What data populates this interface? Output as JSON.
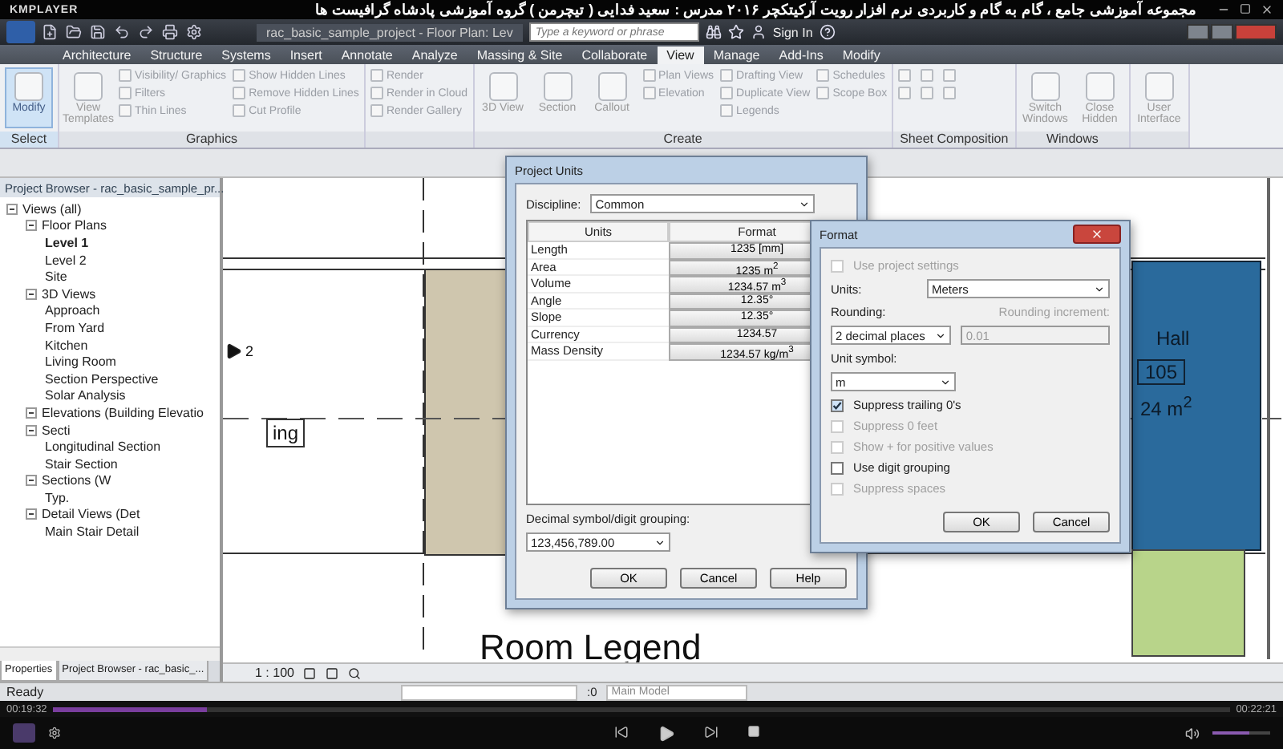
{
  "player": {
    "brand": "KMPLAYER",
    "title": "مجموعه آموزشی جامع ، گام به گام و کاربردی نرم افزار رویت آرکیتکچر ۲۰۱۶   مدرس : سعید فدایی ( تیچرمن ) گروه آموزشی پادشاه گرافیست ها",
    "elapsed": "00:19:32",
    "total": "00:22:21",
    "progress": {
      "level": 0.13
    },
    "volume": {
      "level": 0.65
    }
  },
  "revit": {
    "file_tab": "rac_basic_sample_project - Floor Plan: Lev",
    "search": {
      "placeholder": "Type a keyword or phrase"
    },
    "sign_in": "Sign In"
  },
  "tabs": [
    {
      "label": "Architecture",
      "selected": false
    },
    {
      "label": "Structure",
      "selected": false
    },
    {
      "label": "Systems",
      "selected": false
    },
    {
      "label": "Insert",
      "selected": false
    },
    {
      "label": "Annotate",
      "selected": false
    },
    {
      "label": "Analyze",
      "selected": false
    },
    {
      "label": "Massing & Site",
      "selected": false
    },
    {
      "label": "Collaborate",
      "selected": false
    },
    {
      "label": "View",
      "selected": true
    },
    {
      "label": "Manage",
      "selected": false
    },
    {
      "label": "Add-Ins",
      "selected": false
    },
    {
      "label": "Modify",
      "selected": false
    }
  ],
  "ribbon": [
    {
      "label": "Select",
      "large": [
        "Modify"
      ],
      "active": true
    },
    {
      "label": "Graphics",
      "large": [
        "View Templates"
      ],
      "columns": [
        [
          "Visibility/ Graphics",
          "Filters",
          "Thin Lines"
        ],
        [
          "Show Hidden Lines",
          "Remove Hidden Lines",
          "Cut Profile"
        ]
      ],
      "active": false
    },
    {
      "columns": [
        [
          "Render",
          "Render in Cloud",
          "Render Gallery"
        ]
      ]
    },
    {
      "label": "Create",
      "large": [
        "3D View",
        "Section",
        "Callout"
      ],
      "columns": [
        [
          "Plan Views",
          "Elevation"
        ],
        [
          "Drafting View",
          "Duplicate View",
          "Legends"
        ],
        [
          "Schedules",
          "Scope Box"
        ]
      ],
      "active": false
    },
    {
      "label": "Sheet Composition"
    },
    {
      "label": "Windows",
      "large": [
        "Switch Windows",
        "Close Hidden"
      ],
      "active": false
    },
    {
      "large": [
        "User Interface"
      ],
      "active": false
    }
  ],
  "browser": {
    "title": "Project Browser - rac_basic_sample_pr...",
    "tree": [
      {
        "label": "Views (all)",
        "expanded": true,
        "children": [
          {
            "label": "Floor Plans",
            "expanded": true,
            "children": [
              {
                "label": "Level 1",
                "selected": true
              },
              {
                "label": "Level 2",
                "selected": false
              },
              {
                "label": "Site",
                "selected": false
              }
            ]
          },
          {
            "label": "3D Views",
            "expanded": true,
            "children": [
              {
                "label": "Approach",
                "selected": false
              },
              {
                "label": "From Yard",
                "selected": false
              },
              {
                "label": "Kitchen",
                "selected": false
              },
              {
                "label": "Living Room",
                "selected": false
              },
              {
                "label": "Section Perspective",
                "selected": false
              },
              {
                "label": "Solar Analysis",
                "selected": false
              }
            ]
          },
          {
            "label": "Elevations (Building Elevatio",
            "expanded": true
          },
          {
            "label": "Secti",
            "expanded": true,
            "children": [
              {
                "label": "Longitudinal Section",
                "selected": false
              },
              {
                "label": "Stair Section",
                "selected": false
              }
            ]
          },
          {
            "label": "Sections (W",
            "expanded": true,
            "children": [
              {
                "label": "Typ.",
                "selected": false
              }
            ]
          },
          {
            "label": "Detail Views (Det",
            "expanded": true,
            "children": [
              {
                "label": "Main Stair Detail",
                "selected": false
              }
            ]
          }
        ]
      }
    ],
    "bottom_tabs": [
      {
        "label": "Properties",
        "selected": true
      },
      {
        "label": "Project Browser - rac_basic_...",
        "selected": false
      }
    ]
  },
  "canvas": {
    "scale": "1 : 100",
    "marker": "2",
    "room_tag": "ing",
    "legend": "Room Legend",
    "hall": {
      "name": "Hall",
      "number": "105",
      "area": "24 m$^{2}$"
    }
  },
  "status_bar": {
    "text": "Ready",
    "count": ":0",
    "model": "Main Model"
  },
  "project_units": {
    "title": "Project Units",
    "discipline_label": "Discipline:",
    "discipline": "Common",
    "columns": [
      "Units",
      "Format"
    ],
    "rows": [
      {
        "unit": "Length",
        "format": "1235 [mm]"
      },
      {
        "unit": "Area",
        "format": "1235 m$^{2}$"
      },
      {
        "unit": "Volume",
        "format": "1234.57 m$^{3}$"
      },
      {
        "unit": "Angle",
        "format": "12.35°"
      },
      {
        "unit": "Slope",
        "format": "12.35°"
      },
      {
        "unit": "Currency",
        "format": "1234.57"
      },
      {
        "unit": "Mass Density",
        "format": "1234.57 kg/m$^{3}$"
      }
    ],
    "grouping_label": "Decimal symbol/digit grouping:",
    "grouping": "123,456,789.00",
    "buttons": [
      "OK",
      "Cancel",
      "Help"
    ]
  },
  "format": {
    "title": "Format",
    "use_project": {
      "label": "Use project settings",
      "checked": false,
      "disabled": true
    },
    "units_label": "Units:",
    "units": "Meters",
    "rounding_label": "Rounding:",
    "rounding": "2 decimal places",
    "increment_label": "Rounding increment:",
    "increment": "0.01",
    "symbol_label": "Unit symbol:",
    "symbol": "m",
    "options": [
      {
        "label": "Suppress trailing 0's",
        "checked": true,
        "disabled": false
      },
      {
        "label": "Suppress 0 feet",
        "checked": false,
        "disabled": true
      },
      {
        "label": "Show + for positive values",
        "checked": false,
        "disabled": true
      },
      {
        "label": "Use digit grouping",
        "checked": false,
        "disabled": false
      },
      {
        "label": "Suppress spaces",
        "checked": false,
        "disabled": true
      }
    ],
    "buttons": [
      "OK",
      "Cancel"
    ]
  }
}
